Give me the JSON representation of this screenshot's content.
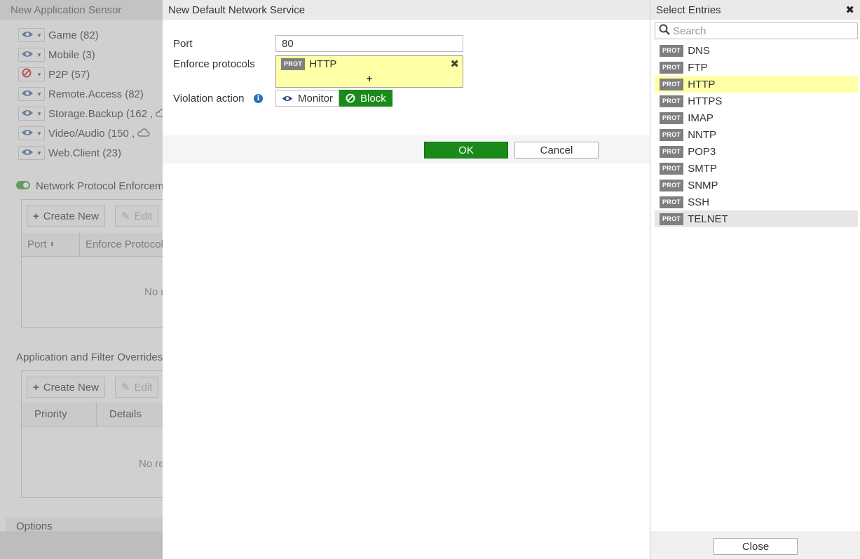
{
  "background": {
    "title": "New Application Sensor",
    "categories": [
      {
        "name": "Game",
        "count": "(82)",
        "action": "monitor"
      },
      {
        "name": "Mobile",
        "count": "(3)",
        "action": "monitor"
      },
      {
        "name": "P2P",
        "count": "(57)",
        "action": "block"
      },
      {
        "name": "Remote.Access",
        "count": "(82)",
        "action": "monitor"
      },
      {
        "name": "Storage.Backup",
        "count": "(162 ,",
        "action": "monitor"
      },
      {
        "name": "Video/Audio",
        "count": "(150 ,",
        "action": "monitor"
      },
      {
        "name": "Web.Client",
        "count": "(23)",
        "action": "monitor"
      }
    ],
    "network_protocol": {
      "title": "Network Protocol Enforcem",
      "create_new": "Create New",
      "edit": "Edit",
      "col_port": "Port",
      "col_enforce": "Enforce Protocol",
      "empty": "No r"
    },
    "overrides": {
      "title": "Application and Filter Overrides",
      "create_new": "Create New",
      "edit": "Edit",
      "col_priority": "Priority",
      "col_details": "Details",
      "empty": "No re"
    },
    "options": "Options"
  },
  "dialog": {
    "title": "New Default Network Service",
    "port_label": "Port",
    "port_value": "80",
    "enforce_label": "Enforce protocols",
    "selected_protocols": [
      {
        "badge": "PROT",
        "name": "HTTP"
      }
    ],
    "add_symbol": "+",
    "violation_label": "Violation action",
    "actions": {
      "monitor": "Monitor",
      "block": "Block",
      "selected": "block"
    },
    "ok": "OK",
    "cancel": "Cancel"
  },
  "panel": {
    "title": "Select Entries",
    "search_placeholder": "Search",
    "entries": [
      {
        "badge": "PROT",
        "name": "DNS"
      },
      {
        "badge": "PROT",
        "name": "FTP"
      },
      {
        "badge": "PROT",
        "name": "HTTP"
      },
      {
        "badge": "PROT",
        "name": "HTTPS"
      },
      {
        "badge": "PROT",
        "name": "IMAP"
      },
      {
        "badge": "PROT",
        "name": "NNTP"
      },
      {
        "badge": "PROT",
        "name": "POP3"
      },
      {
        "badge": "PROT",
        "name": "SMTP"
      },
      {
        "badge": "PROT",
        "name": "SNMP"
      },
      {
        "badge": "PROT",
        "name": "SSH"
      },
      {
        "badge": "PROT",
        "name": "TELNET"
      }
    ],
    "selected_entry": "HTTP",
    "hovered_entry": "TELNET",
    "close": "Close"
  },
  "colors": {
    "accent_green": "#1a8a1a",
    "selection_yellow": "#ffffa6",
    "badge_gray": "#7f7f7f",
    "info_blue": "#2a6ebb"
  }
}
